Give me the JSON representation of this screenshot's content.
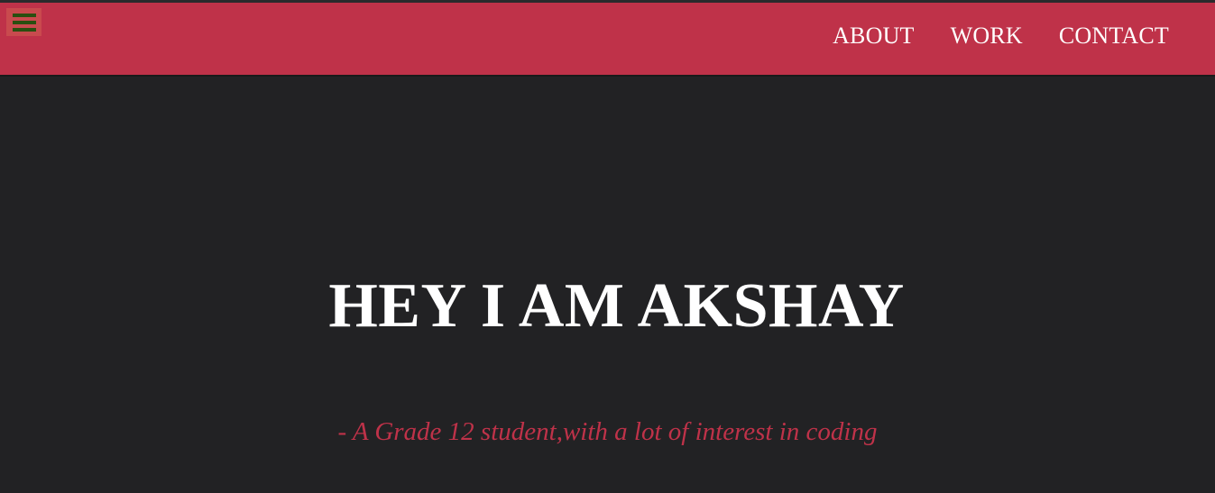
{
  "navbar": {
    "menu_icon": "hamburger-menu-icon",
    "links": [
      {
        "label": "ABOUT"
      },
      {
        "label": "WORK"
      },
      {
        "label": "CONTACT"
      }
    ]
  },
  "hero": {
    "title": "HEY I AM AKSHAY",
    "subtitle": "- A Grade 12 student,with a lot of interest in coding"
  },
  "colors": {
    "navbar_bg": "#bf3249",
    "page_bg": "#222224",
    "menu_icon": "#2a4f10",
    "subtitle": "#bf3249"
  }
}
